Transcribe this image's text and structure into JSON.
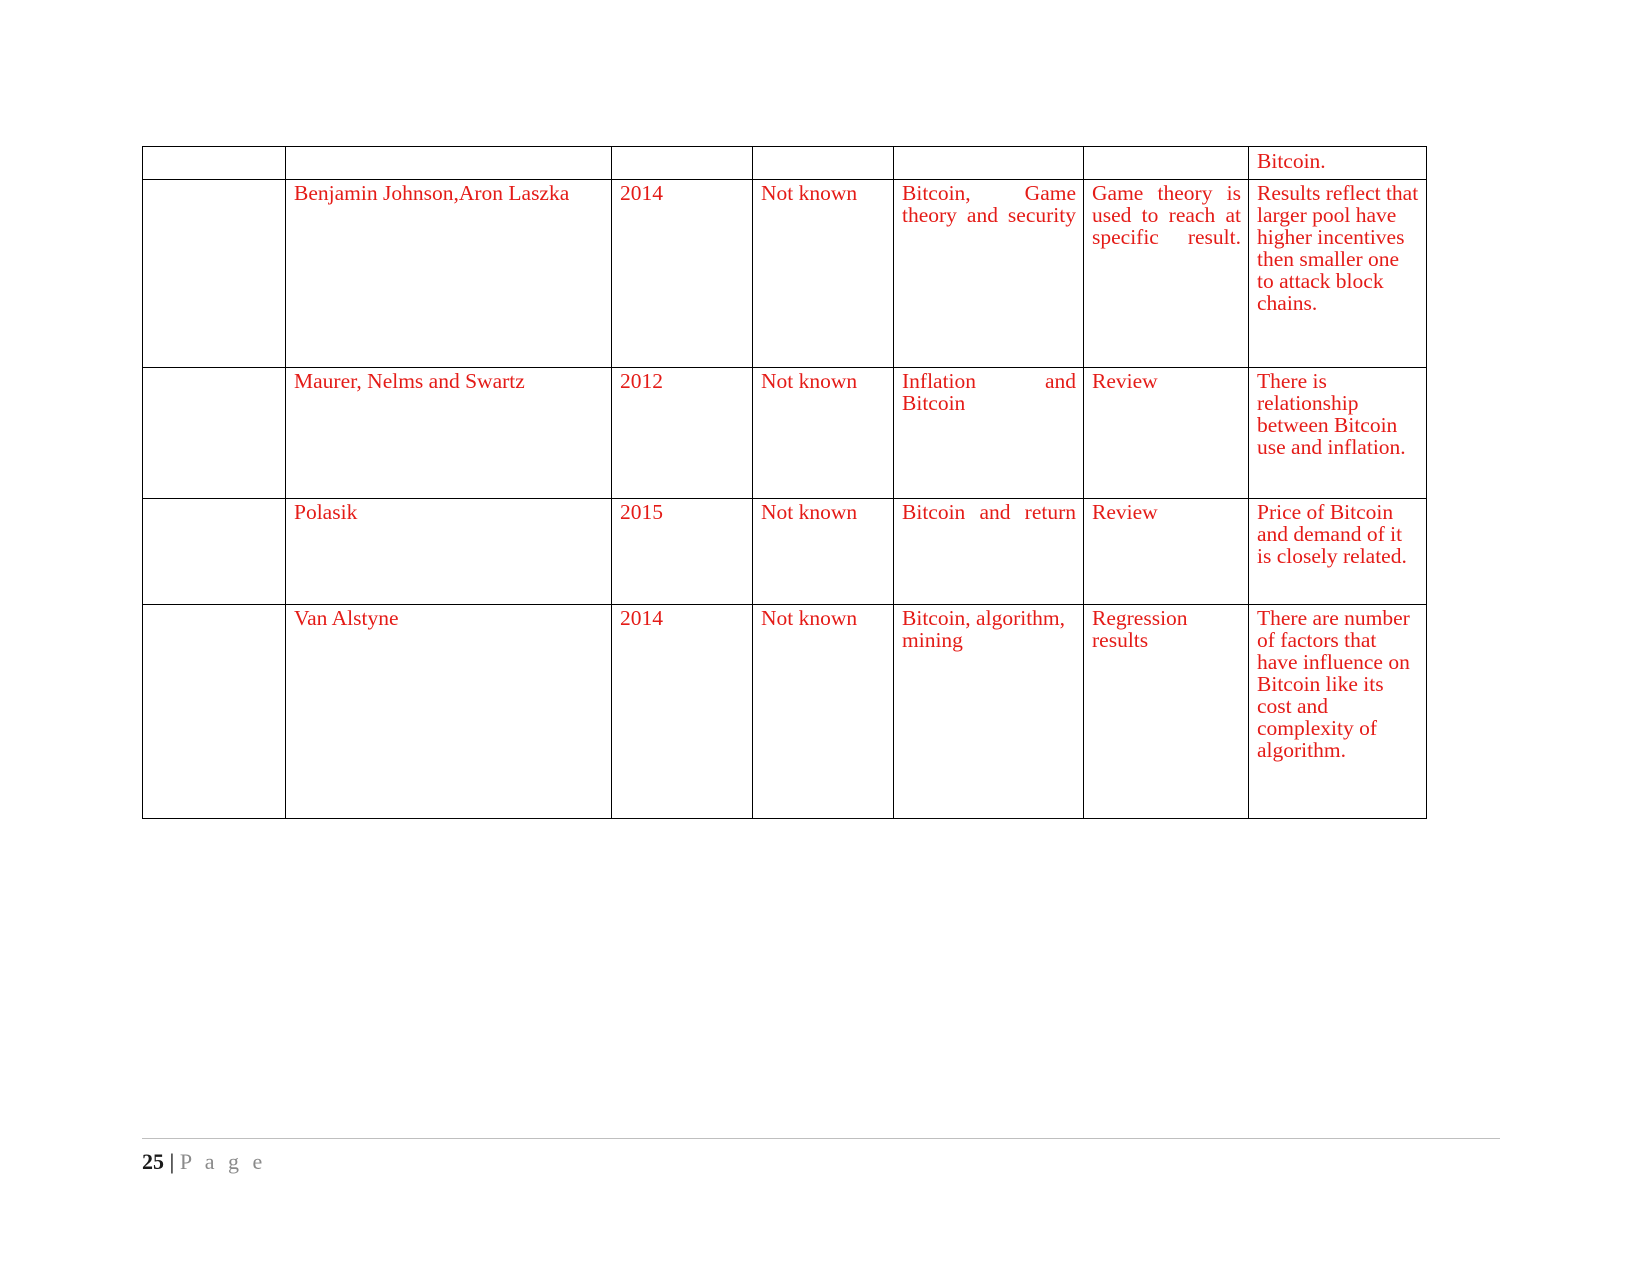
{
  "document": {
    "footer": {
      "page_number": "25",
      "separator": " | ",
      "label": "P a g e"
    },
    "text_color": "#e41b17",
    "border_color": "#000000"
  },
  "table": {
    "name": "literature-review-table",
    "columns": 7,
    "continued_row": {
      "cells": [
        "",
        "",
        "",
        "",
        "",
        "",
        "Bitcoin."
      ]
    },
    "rows": [
      {
        "author": "Benjamin Johnson,Aron Laszka",
        "year": "2014",
        "sample": "Not known",
        "variables": "Bitcoin, Game theory and security",
        "method": "Game theory is used to reach at specific result.",
        "findings": "Results reflect that larger pool have higher incentives then smaller one to attack block chains."
      },
      {
        "author": "Maurer, Nelms and Swartz",
        "year": "2012",
        "sample": "Not known",
        "variables": "Inflation and Bitcoin",
        "method": "Review",
        "findings": "There is relationship between Bitcoin use and inflation."
      },
      {
        "author": "Polasik",
        "year": "2015",
        "sample": "Not known",
        "variables": "Bitcoin and return",
        "method": "Review",
        "findings": "Price of Bitcoin and demand of it is closely related."
      },
      {
        "author": "Van Alstyne",
        "year": "2014",
        "sample": "Not known",
        "variables": "Bitcoin, algorithm, mining",
        "method": "Regression results",
        "findings": "There are number of factors that have influence on Bitcoin like its cost and complexity of algorithm."
      }
    ]
  }
}
